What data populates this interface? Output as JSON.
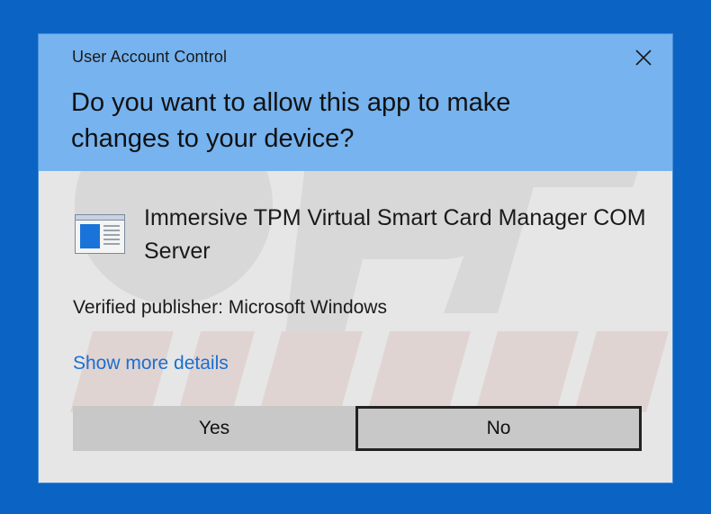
{
  "dialog": {
    "title": "User Account Control",
    "question": "Do you want to allow this app to make changes to your device?",
    "app_name": "Immersive TPM Virtual Smart Card Manager COM Server",
    "publisher": "Verified publisher: Microsoft Windows",
    "details_link": "Show more details",
    "yes_label": "Yes",
    "no_label": "No",
    "close_icon": "close-icon",
    "app_icon": "application-window-icon"
  },
  "colors": {
    "desktop_background": "#0b64c3",
    "header_background": "#76b3ef",
    "body_background": "#e6e6e6",
    "link": "#1a6fcf",
    "button": "#c8c8c8"
  }
}
